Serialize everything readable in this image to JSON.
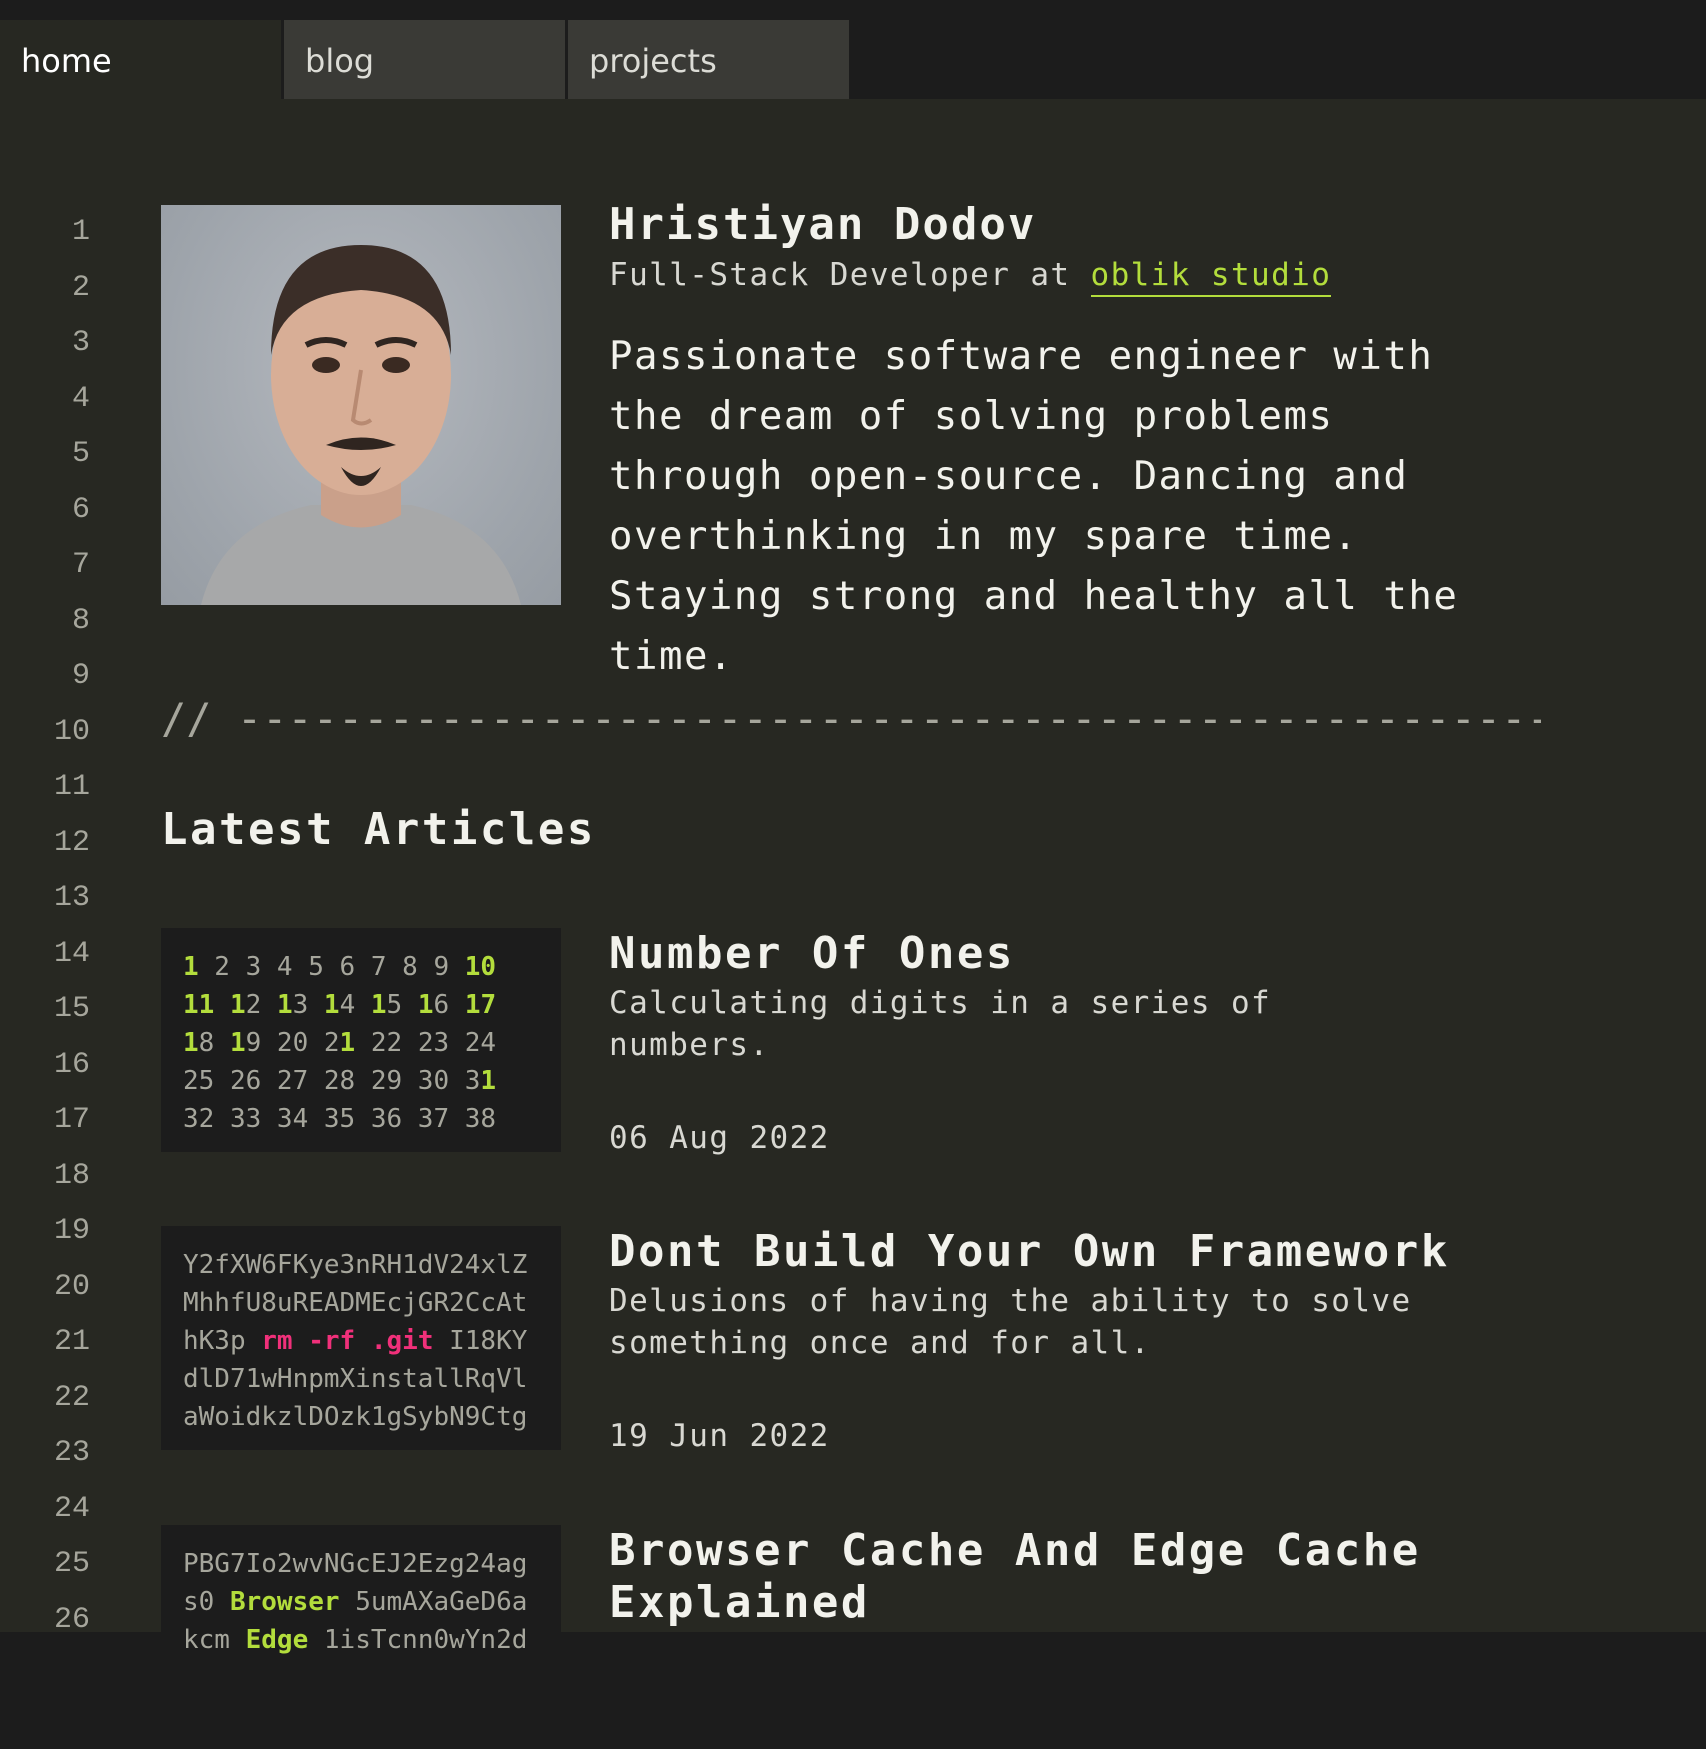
{
  "tabs": [
    {
      "label": "home",
      "active": true
    },
    {
      "label": "blog",
      "active": false
    },
    {
      "label": "projects",
      "active": false
    }
  ],
  "line_numbers": [
    "1",
    "2",
    "3",
    "4",
    "5",
    "6",
    "7",
    "8",
    "9",
    "10",
    "11",
    "12",
    "13",
    "14",
    "15",
    "16",
    "17",
    "18",
    "19",
    "20",
    "21",
    "22",
    "23",
    "24",
    "25",
    "26"
  ],
  "profile": {
    "name": "Hristiyan Dodov",
    "role_prefix": "Full-Stack Developer at ",
    "company": "oblik studio",
    "bio": "Passionate software engineer with the dream of solving problems through open-source. Dancing and overthinking in my spare time. Staying strong and healthy all the time."
  },
  "divider": "// ------------------------------------------------------",
  "section_title": "Latest Articles",
  "articles": [
    {
      "title": "Number Of Ones",
      "description": "Calculating digits in a series of numbers.",
      "date": "06 Aug 2022",
      "thumb_lines": [
        [
          [
            "1",
            "hl"
          ],
          [
            " 2 3 4 5 6 7 8 9 ",
            ""
          ],
          [
            "1",
            "hl"
          ],
          [
            "0",
            "hl"
          ]
        ],
        [
          [
            "11",
            "hl"
          ],
          [
            " ",
            ""
          ],
          [
            "1",
            "hl"
          ],
          [
            "2 ",
            ""
          ],
          [
            "1",
            "hl"
          ],
          [
            "3 ",
            ""
          ],
          [
            "1",
            "hl"
          ],
          [
            "4 ",
            ""
          ],
          [
            "1",
            "hl"
          ],
          [
            "5 ",
            ""
          ],
          [
            "1",
            "hl"
          ],
          [
            "6 ",
            ""
          ],
          [
            "1",
            "hl"
          ],
          [
            "7",
            "hl"
          ]
        ],
        [
          [
            "1",
            "hl"
          ],
          [
            "8 ",
            ""
          ],
          [
            "1",
            "hl"
          ],
          [
            "9 20 2",
            ""
          ],
          [
            "1",
            "hl"
          ],
          [
            " 22 23 24",
            ""
          ]
        ],
        [
          [
            "25 26 27 28 29 30 3",
            ""
          ],
          [
            "1",
            "hl"
          ]
        ],
        [
          [
            "32 33 34 35 36 37 38",
            ""
          ]
        ]
      ]
    },
    {
      "title": "Dont Build Your Own Framework",
      "description": "Delusions of having the ability to solve something once and for all.",
      "date": "19 Jun 2022",
      "thumb_lines": [
        [
          [
            "Y2fXW6FKye3nRH1dV24xlZ",
            ""
          ]
        ],
        [
          [
            "MhhfU8uREADMEcjGR2CcAt",
            ""
          ]
        ],
        [
          [
            "hK3p ",
            ""
          ],
          [
            "rm -rf .git",
            "rd"
          ],
          [
            " I18KY",
            ""
          ]
        ],
        [
          [
            "dlD71wHnpmXinstallRqVl",
            ""
          ]
        ],
        [
          [
            "aWoidkzlDOzk1gSybN9Ctg",
            ""
          ]
        ]
      ]
    },
    {
      "title": "Browser Cache And Edge Cache Explained",
      "description": "",
      "date": "",
      "thumb_lines": [
        [
          [
            "PBG7Io2wvNGcEJ2Ezg24ag",
            ""
          ]
        ],
        [
          [
            "s0 ",
            ""
          ],
          [
            "Browser",
            "hl"
          ],
          [
            " 5umAXaGeD6a",
            ""
          ]
        ],
        [
          [
            "kcm ",
            ""
          ],
          [
            "Edge",
            "hl"
          ],
          [
            " 1isTcnn0wYn2d",
            ""
          ]
        ]
      ]
    }
  ],
  "colors": {
    "background": "#272822",
    "tabbar": "#1c1c1c",
    "accent": "#b3dd3c",
    "danger": "#f0307a"
  }
}
